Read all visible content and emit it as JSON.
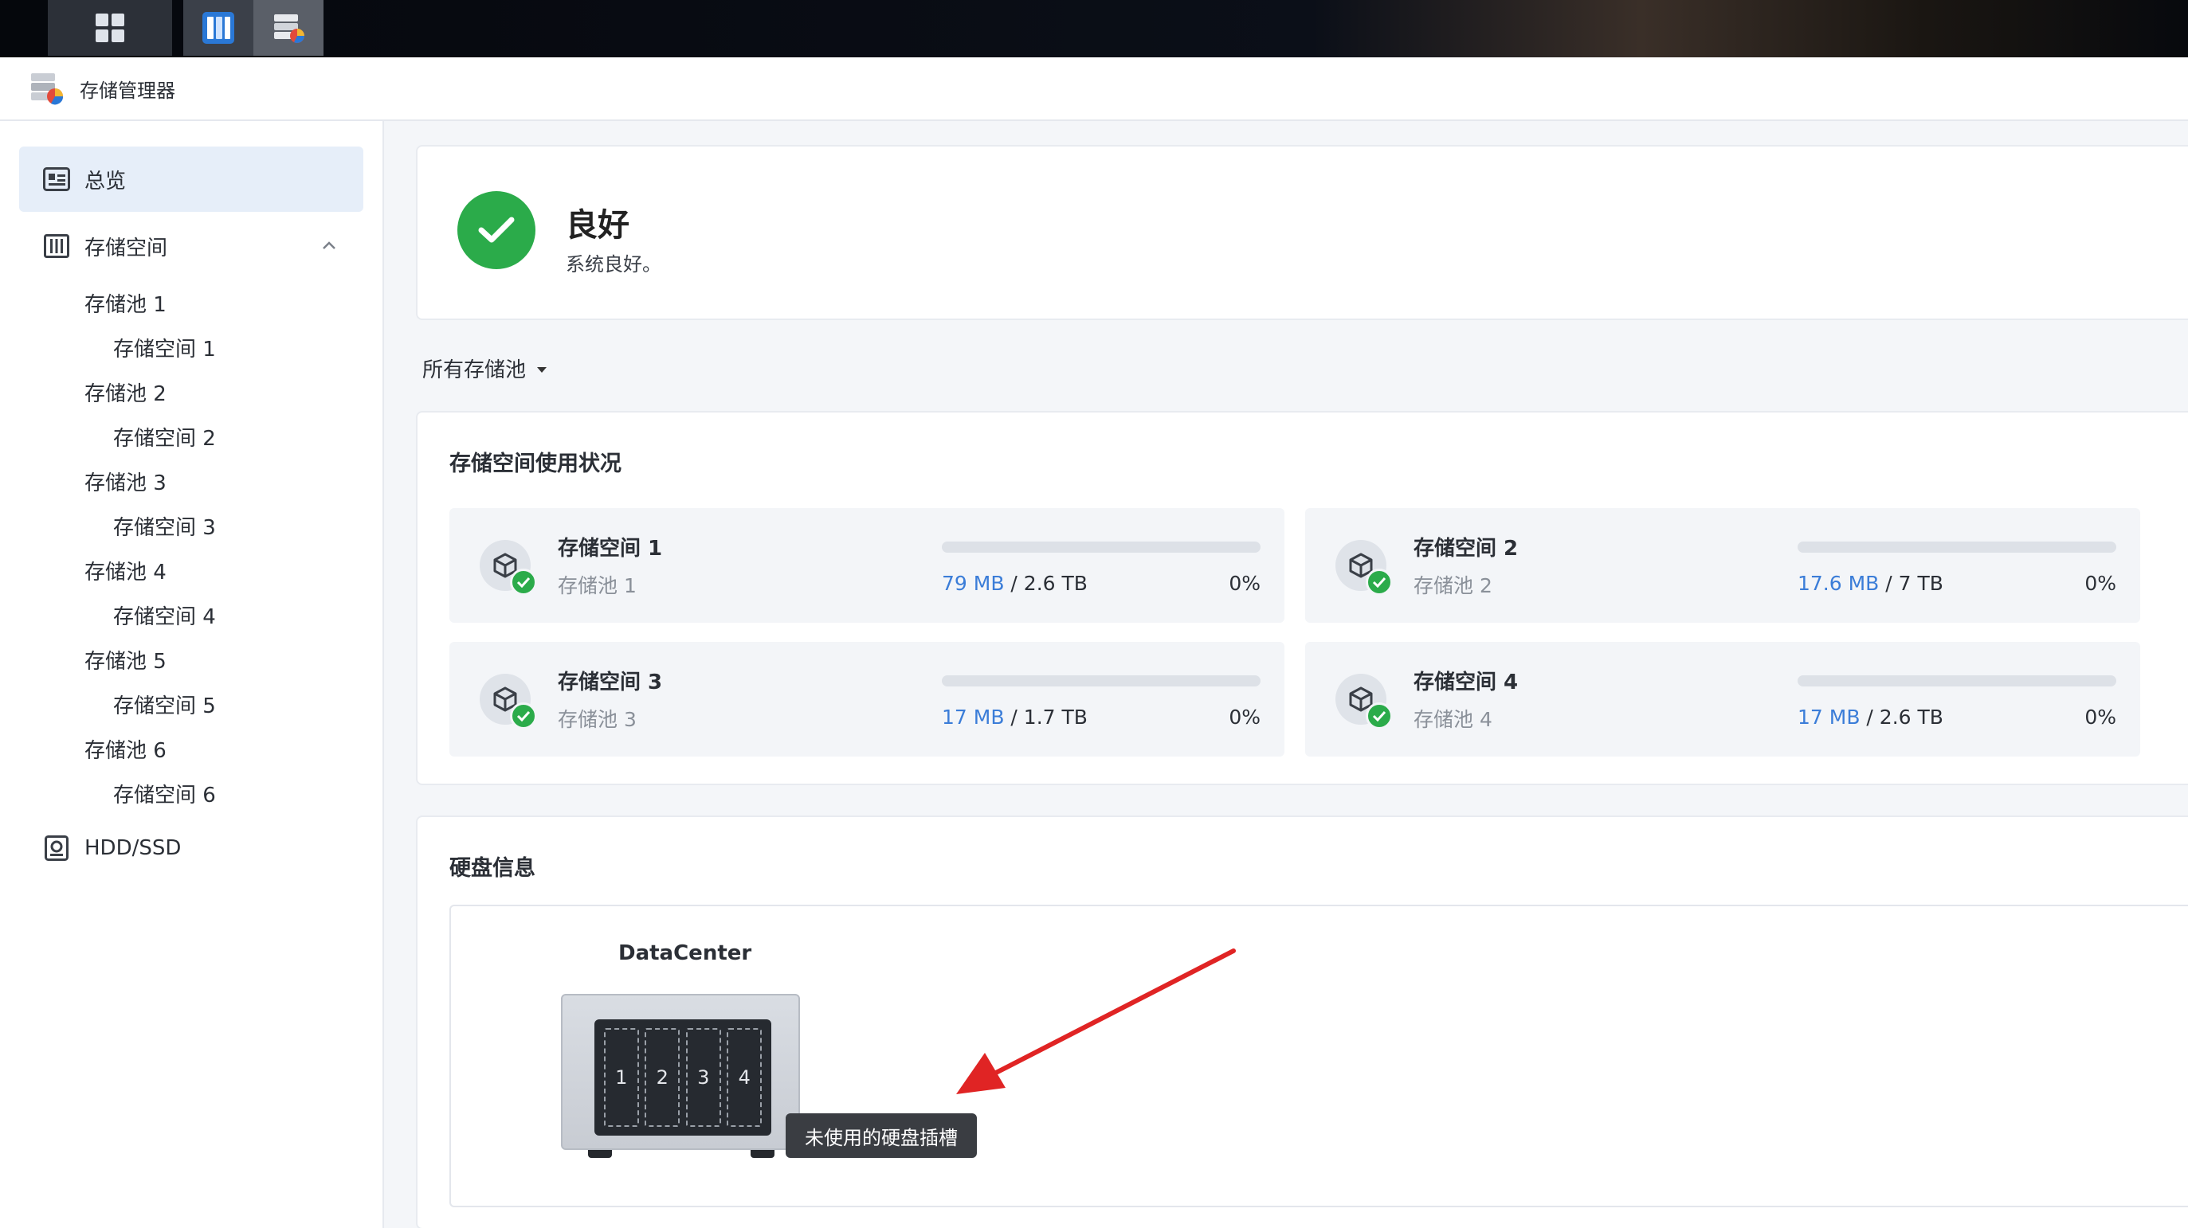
{
  "app": {
    "title": "存储管理器"
  },
  "sidebar": {
    "overview": "总览",
    "storage": "存储空间",
    "tree": [
      {
        "label": "存储池 1",
        "level": 1
      },
      {
        "label": "存储空间 1",
        "level": 2
      },
      {
        "label": "存储池 2",
        "level": 1
      },
      {
        "label": "存储空间 2",
        "level": 2
      },
      {
        "label": "存储池 3",
        "level": 1
      },
      {
        "label": "存储空间 3",
        "level": 2
      },
      {
        "label": "存储池 4",
        "level": 1
      },
      {
        "label": "存储空间 4",
        "level": 2
      },
      {
        "label": "存储池 5",
        "level": 1
      },
      {
        "label": "存储空间 5",
        "level": 2
      },
      {
        "label": "存储池 6",
        "level": 1
      },
      {
        "label": "存储空间 6",
        "level": 2
      }
    ],
    "hdd": "HDD/SSD"
  },
  "status": {
    "title": "良好",
    "message": "系统良好。"
  },
  "filter": {
    "label": "所有存储池"
  },
  "usage": {
    "title": "存储空间使用状况",
    "volumes": [
      {
        "name": "存储空间 1",
        "pool": "存储池 1",
        "used": "79 MB",
        "total": " / 2.6 TB",
        "percent_label": "0%",
        "percent": 0
      },
      {
        "name": "存储空间 2",
        "pool": "存储池 2",
        "used": "17.6 MB",
        "total": " / 7 TB",
        "percent_label": "0%",
        "percent": 0
      },
      {
        "name": "存储空间 3",
        "pool": "存储池 3",
        "used": "17 MB",
        "total": " / 1.7 TB",
        "percent_label": "0%",
        "percent": 0
      },
      {
        "name": "存储空间 4",
        "pool": "存储池 4",
        "used": "17 MB",
        "total": " / 2.6 TB",
        "percent_label": "0%",
        "percent": 0
      }
    ]
  },
  "disk": {
    "title": "硬盘信息",
    "device_name": "DataCenter",
    "slots": [
      "1",
      "2",
      "3",
      "4"
    ],
    "tooltip": "未使用的硬盘插槽"
  },
  "colors": {
    "accent": "#3b7dd8",
    "success": "#2bab4a",
    "annotation_arrow": "#e02424"
  }
}
